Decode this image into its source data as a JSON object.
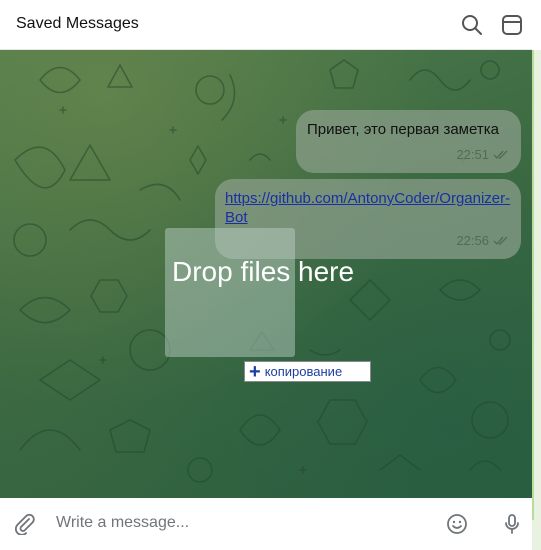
{
  "header": {
    "title": "Saved Messages",
    "search_icon": "search-icon",
    "sidebar_icon": "sidebar-toggle-icon"
  },
  "messages": [
    {
      "text": "Привет, это первая заметка",
      "time": "22:51",
      "status": "read-double-check"
    },
    {
      "text": "https://github.com/AntonyCoder/Organizer-Bot",
      "time": "22:56",
      "status": "read-double-check",
      "is_link": true
    }
  ],
  "drop_overlay": {
    "label": "Drop files here"
  },
  "drag_tooltip": {
    "label": "копирование",
    "icon": "plus-icon"
  },
  "composer": {
    "placeholder": "Write a message...",
    "attach_icon": "paperclip-icon",
    "emoji_icon": "emoji-icon",
    "mic_icon": "microphone-icon"
  },
  "colors": {
    "bubble": "#8ca08c",
    "link": "#1a2fa6",
    "timestamp": "#4e6e50",
    "background_green": "#3f6c43"
  }
}
